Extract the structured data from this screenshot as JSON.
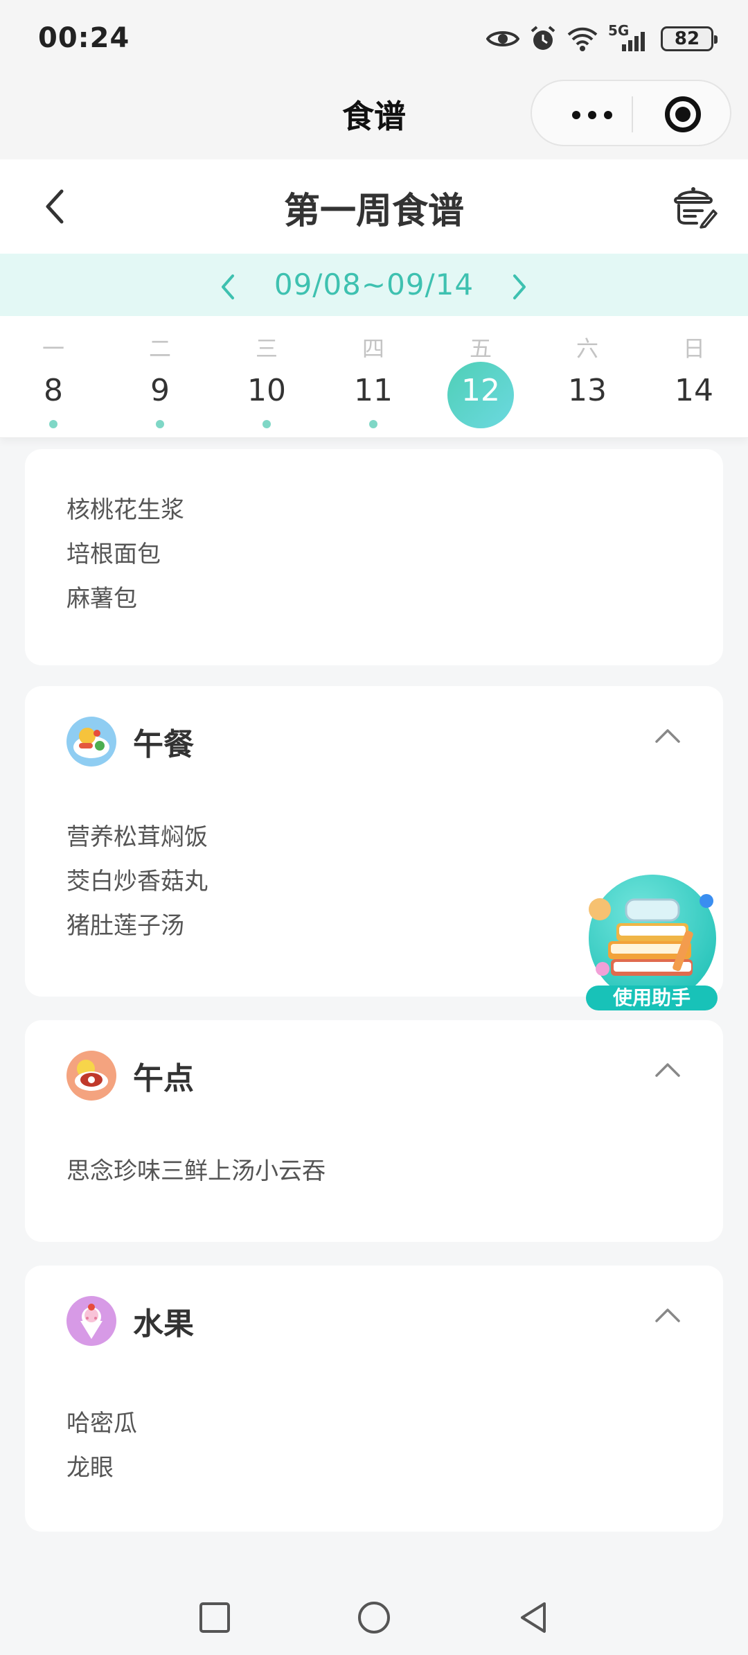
{
  "status_bar": {
    "time": "00:24",
    "signal": "5G",
    "battery": "82"
  },
  "mini_program": {
    "title": "食谱"
  },
  "header": {
    "title": "第一周食谱"
  },
  "week": {
    "range": "09/08~09/14"
  },
  "days": [
    {
      "weekday": "一",
      "day": "8",
      "has_dot": true
    },
    {
      "weekday": "二",
      "day": "9",
      "has_dot": true
    },
    {
      "weekday": "三",
      "day": "10",
      "has_dot": true
    },
    {
      "weekday": "四",
      "day": "11",
      "has_dot": true
    },
    {
      "weekday": "五",
      "day": "12",
      "selected": true
    },
    {
      "weekday": "六",
      "day": "13"
    },
    {
      "weekday": "日",
      "day": "14"
    }
  ],
  "breakfast_items": [
    "核桃花生浆",
    "培根面包",
    "麻薯包"
  ],
  "meals": [
    {
      "title": "午餐",
      "items": [
        "营养松茸焖饭",
        "茭白炒香菇丸",
        "猪肚莲子汤"
      ]
    },
    {
      "title": "午点",
      "items": [
        "思念珍味三鲜上汤小云吞"
      ]
    },
    {
      "title": "水果",
      "items": [
        "哈密瓜",
        "龙眼"
      ]
    }
  ],
  "helper": {
    "label": "使用助手"
  },
  "colors": {
    "accent": "#3ec1b0",
    "selected_day": "#5dd3c7",
    "dot": "#7fd7c6"
  }
}
